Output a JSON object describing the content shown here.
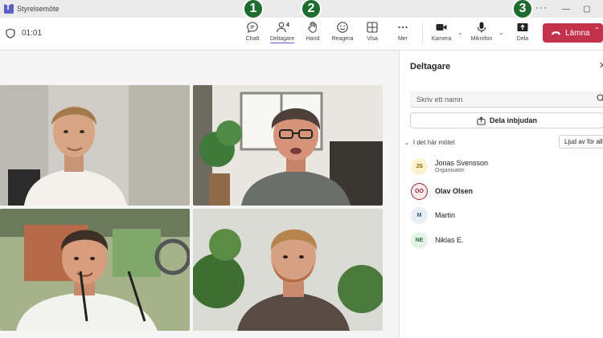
{
  "window": {
    "title": "Styrelsemöte",
    "more": "···",
    "minimize": "—",
    "maximize": "▢",
    "close": "✕"
  },
  "toolbar": {
    "timer": "01:01",
    "buttons": [
      {
        "label": "Chatt",
        "icon": "chat-icon"
      },
      {
        "label": "Deltagare",
        "icon": "people-icon",
        "count": "4"
      },
      {
        "label": "Hand",
        "icon": "raise-hand-icon"
      },
      {
        "label": "Reagera",
        "icon": "emoji-icon"
      },
      {
        "label": "Visa",
        "icon": "grid-view-icon"
      },
      {
        "label": "Mer",
        "icon": "more-icon"
      },
      {
        "label": "Kamera",
        "icon": "camera-icon"
      },
      {
        "label": "Mikrofon",
        "icon": "microphone-icon"
      },
      {
        "label": "Dela",
        "icon": "share-screen-icon"
      }
    ],
    "leave_label": "Lämna",
    "leave_color": "#c4314b"
  },
  "badges": [
    "1",
    "2",
    "3"
  ],
  "badge_color": "#1e6b2e",
  "panel": {
    "title": "Deltagare",
    "close": "✕",
    "search_placeholder": "Skriv ett namn",
    "share_invite_label": "Dela inbjudan",
    "section_label": "I det här mötet",
    "mute_all_label": "Ljud av för alla",
    "participants": [
      {
        "initials": "JS",
        "name": "Jonas Svensson",
        "role": "Organisatör",
        "color": "#fdf3d0",
        "text_color": "#835c00"
      },
      {
        "initials": "OO",
        "name": "Olav Olsen",
        "role": "",
        "color": "#fde7e9",
        "text_color": "#8a2d3b"
      },
      {
        "initials": "M",
        "name": "Martin",
        "role": "",
        "color": "#e8eef5",
        "text_color": "#3a5a7c"
      },
      {
        "initials": "NE",
        "name": "Niklas E.",
        "role": "",
        "color": "#e3f4e6",
        "text_color": "#2d6b3a"
      }
    ]
  }
}
